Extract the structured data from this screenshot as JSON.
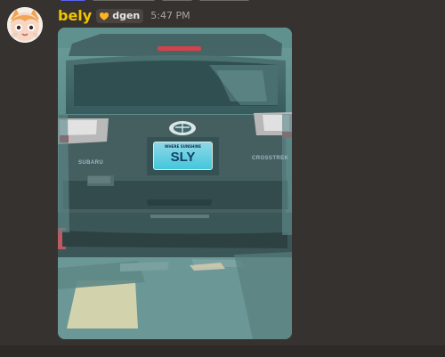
{
  "message": {
    "author": "bely",
    "role_tag": "dgen",
    "role_icon": "heart-icon",
    "timestamp": "5:47 PM",
    "colors": {
      "background": "#36322f",
      "username": "#f0c500",
      "timestamp": "#a8a39e"
    }
  },
  "attachment": {
    "plate_text": "SLY",
    "plate_state": "WHERE SUNSHINE",
    "vehicle_brand": "SUBARU",
    "vehicle_model": "CROSSTREK"
  }
}
